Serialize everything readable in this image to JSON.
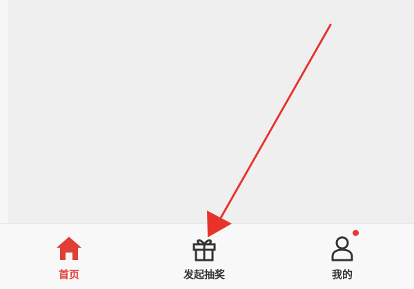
{
  "colors": {
    "accent": "#e03e36",
    "text": "#333333",
    "badge": "#e53935",
    "annotation": "#e8332b",
    "content_bg": "#efefef",
    "tabbar_bg": "#f8f8f8"
  },
  "tab_bar": {
    "tabs": [
      {
        "label": "首页",
        "icon": "home-icon",
        "active": true
      },
      {
        "label": "发起抽奖",
        "icon": "gift-icon",
        "active": false
      },
      {
        "label": "我的",
        "icon": "user-icon",
        "active": false,
        "has_badge": true
      }
    ]
  },
  "annotation": {
    "type": "arrow",
    "points_to": "发起抽奖"
  }
}
